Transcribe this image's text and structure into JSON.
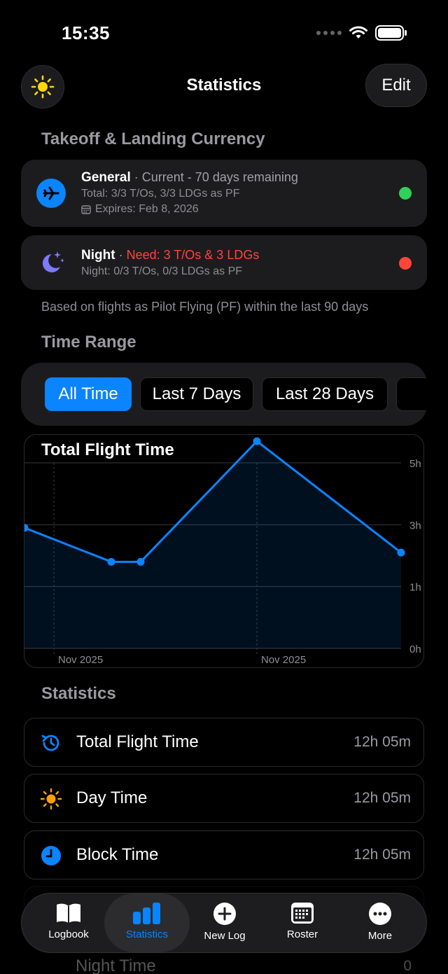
{
  "status_bar": {
    "time": "15:35"
  },
  "nav": {
    "title": "Statistics",
    "edit_label": "Edit"
  },
  "currency": {
    "header": "Takeoff & Landing Currency",
    "general": {
      "name": "General",
      "status": "· Current - 70 days remaining",
      "total": "Total: 3/3 T/Os, 3/3 LDGs as PF",
      "expires": "Expires: Feb 8, 2026",
      "dot_color": "#30d158"
    },
    "night": {
      "name": "Night",
      "sep": "·",
      "status": "Need: 3 T/Os & 3 LDGs",
      "detail": "Night: 0/3 T/Os, 0/3 LDGs as PF",
      "dot_color": "#ff453a"
    },
    "footnote": "Based on flights as Pilot Flying (PF) within the last 90 days"
  },
  "time_range": {
    "header": "Time Range",
    "options": [
      "All Time",
      "Last 7 Days",
      "Last 28 Days"
    ],
    "selected": "All Time"
  },
  "chart_data": {
    "type": "area",
    "title": "Total Flight Time",
    "x_tick_labels": [
      "Nov 2025",
      "Nov 2025"
    ],
    "y_tick_labels": [
      "5h",
      "3h",
      "1h",
      "0h"
    ],
    "ylim": [
      0,
      6
    ],
    "series": [
      {
        "values": [
          2.9,
          1.8,
          1.8,
          5.7,
          2.1
        ]
      }
    ],
    "accent": "#0a84ff",
    "grid": true
  },
  "statistics": {
    "header": "Statistics",
    "rows": [
      {
        "label": "Total Flight Time",
        "value": "12h 05m",
        "icon": "clock-history-icon"
      },
      {
        "label": "Day Time",
        "value": "12h 05m",
        "icon": "sun-icon"
      },
      {
        "label": "Block Time",
        "value": "12h 05m",
        "icon": "clock-icon"
      }
    ],
    "partial_rows": [
      {
        "label": "Night Time",
        "value": "0"
      }
    ]
  },
  "tabs": [
    {
      "label": "Logbook",
      "icon": "book-icon"
    },
    {
      "label": "Statistics",
      "icon": "chart-bars-icon",
      "active": true
    },
    {
      "label": "New Log",
      "icon": "plus-circle-icon"
    },
    {
      "label": "Roster",
      "icon": "calendar-grid-icon"
    },
    {
      "label": "More",
      "icon": "ellipsis-circle-icon"
    }
  ]
}
